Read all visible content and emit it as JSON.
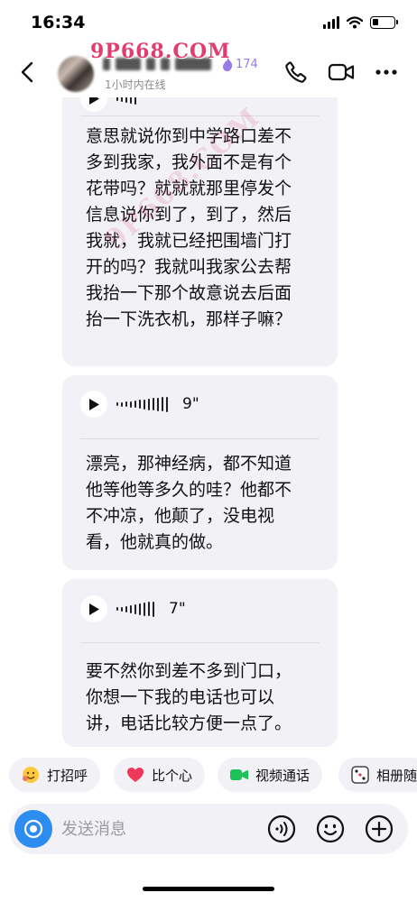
{
  "status_bar": {
    "time": "16:34",
    "battery_level": 0.3
  },
  "header": {
    "online_status": "1小时内在线",
    "flame_count": "174",
    "watermark": "9P668.COM",
    "icons": [
      "back-icon",
      "phone-icon",
      "video-camera-icon",
      "more-icon"
    ]
  },
  "chat": {
    "diagonal_watermark": "9P668.COM",
    "messages": [
      {
        "type": "voice",
        "duration": "",
        "transcript": [
          "意思就说你到中学路口差不",
          "多到我家，我外面不是有个",
          "花带吗？就就就那里停发个",
          "信息说你到了，到了，然后",
          "我就，我就已经把围墙门打",
          "开的吗？我就叫我家公去帮",
          "我抬一下那个故意说去后面",
          "抬一下洗衣机，那样子嘛？"
        ]
      },
      {
        "type": "voice",
        "duration": "9\"",
        "transcript": [
          "漂亮，那神经病，都不知道",
          "他等他等多久的哇？他都不",
          "不冲凉，他颠了，没电视",
          "看，他就真的做。"
        ]
      },
      {
        "type": "voice",
        "duration": "7\"",
        "transcript": [
          "要不然你到差不多到门口，",
          "你想一下我的电话也可以",
          "讲，电话比较方便一点了。"
        ]
      }
    ]
  },
  "quick_replies": [
    {
      "label": "打招呼",
      "icon": "wave-emoji-icon"
    },
    {
      "label": "比个心",
      "icon": "heart-icon"
    },
    {
      "label": "视频通话",
      "icon": "video-call-icon"
    },
    {
      "label": "相册随",
      "icon": "dice-icon"
    }
  ],
  "input_bar": {
    "placeholder": "发送消息",
    "icons": [
      "camera-icon",
      "voice-input-icon",
      "emoji-icon",
      "plus-icon"
    ],
    "accent_color": "#2d8cf0"
  },
  "colors": {
    "bubble": "#f1f1f6",
    "watermark": "#e23d6e",
    "flame": "#9a7ce8"
  }
}
